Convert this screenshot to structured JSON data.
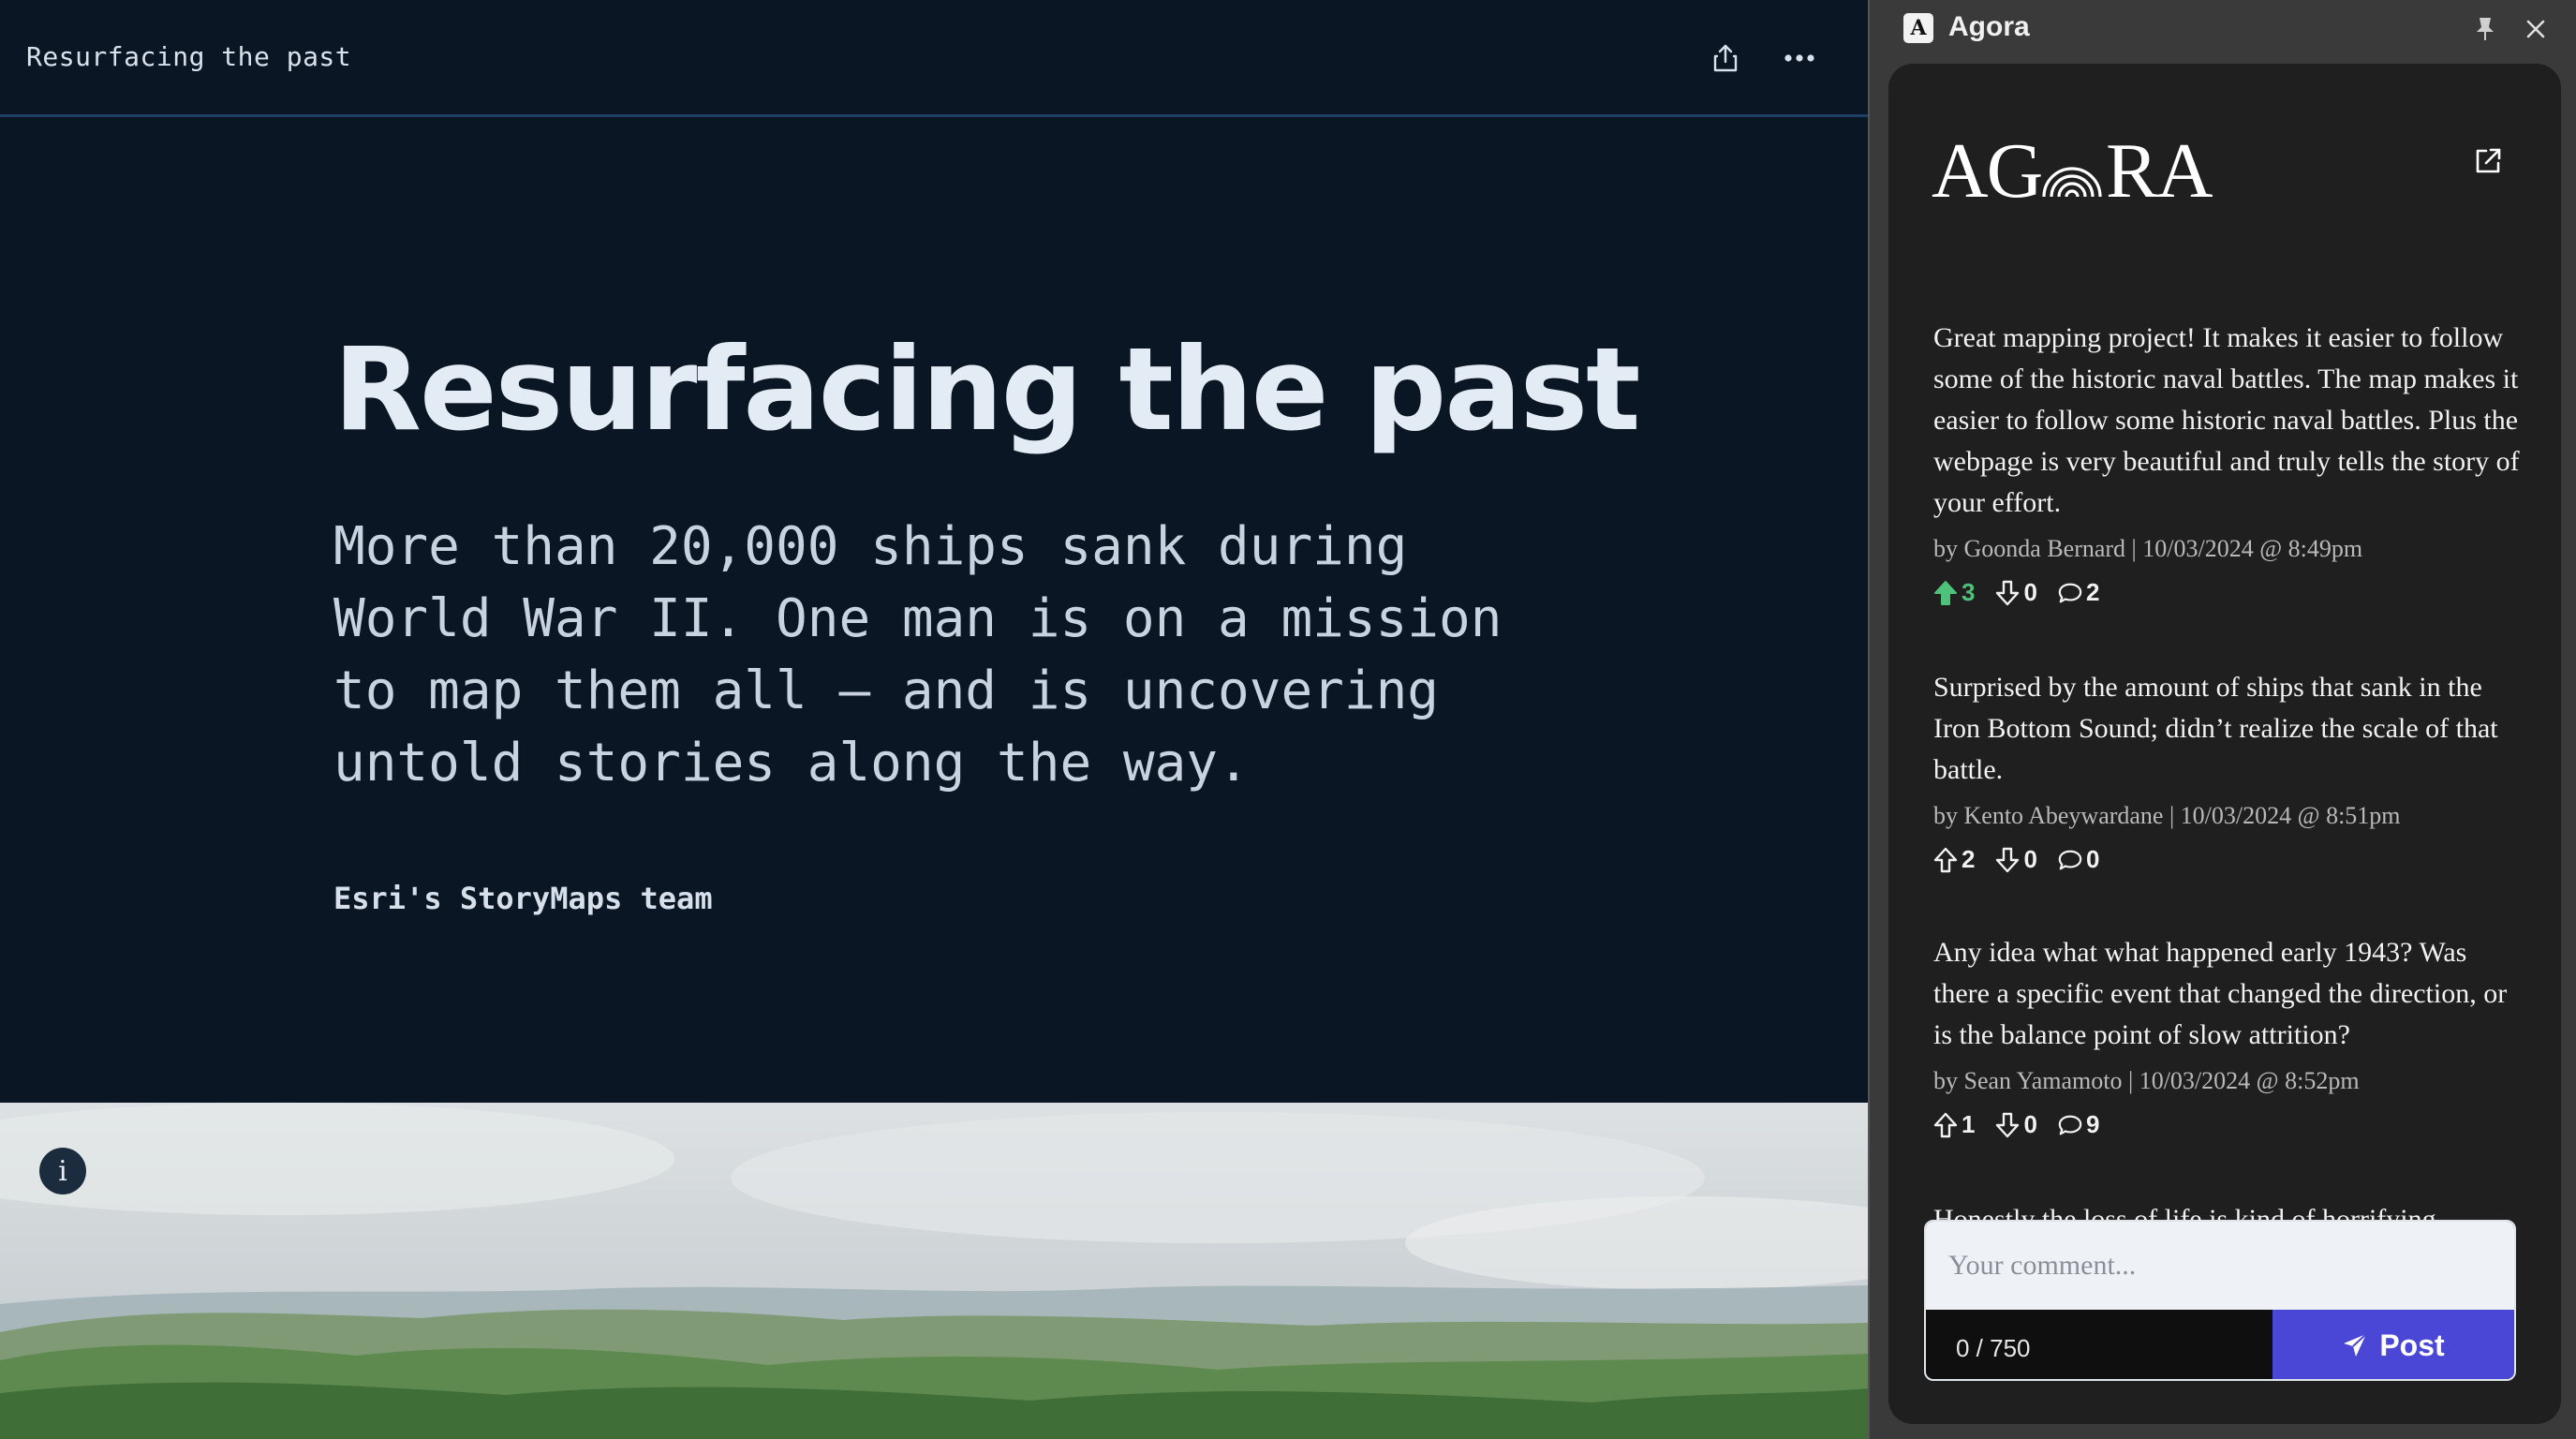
{
  "story": {
    "header_title": "Resurfacing the past",
    "hero_title": "Resurfacing the past",
    "hero_subtitle": "More than 20,000 ships sank during World War II. One man is on a mission to map them all — and is uncovering untold stories along the way.",
    "byline": "Esri's StoryMaps team",
    "info_icon_glyph": "i"
  },
  "sidebar": {
    "window_title": "Agora",
    "favicon_letter": "A",
    "logo_text": "AGORA",
    "comments": [
      {
        "text": "Great mapping project! It makes it easier to follow some of the historic naval battles. The map makes it easier to follow some historic naval battles. Plus the webpage is very beautiful and truly tells the story of your effort.",
        "meta": "by Goonda Bernard | 10/03/2024 @ 8:49pm",
        "upvotes": "3",
        "downvotes": "0",
        "replies": "2",
        "upvoted": true
      },
      {
        "text": "Surprised by the amount of ships that sank in the Iron Bottom Sound; didn’t realize the scale of that battle.",
        "meta": "by Kento Abeywardane | 10/03/2024 @ 8:51pm",
        "upvotes": "2",
        "downvotes": "0",
        "replies": "0",
        "upvoted": false
      },
      {
        "text": "Any idea what what happened early 1943? Was there a specific event that changed the direction, or is the balance point of slow attrition?",
        "meta": "by Sean Yamamoto | 10/03/2024 @ 8:52pm",
        "upvotes": "1",
        "downvotes": "0",
        "replies": "9",
        "upvoted": false
      },
      {
        "text": "Honestly the loss of life is kind of horrifying.",
        "meta": "",
        "upvotes": "",
        "downvotes": "",
        "replies": "",
        "upvoted": false
      }
    ],
    "composer": {
      "placeholder": "Your comment...",
      "counter": "0 / 750",
      "post_label": "Post"
    }
  },
  "colors": {
    "story_bg": "#0b1624",
    "accent": "#4a47d6",
    "upvote_active": "#4ec27a"
  }
}
